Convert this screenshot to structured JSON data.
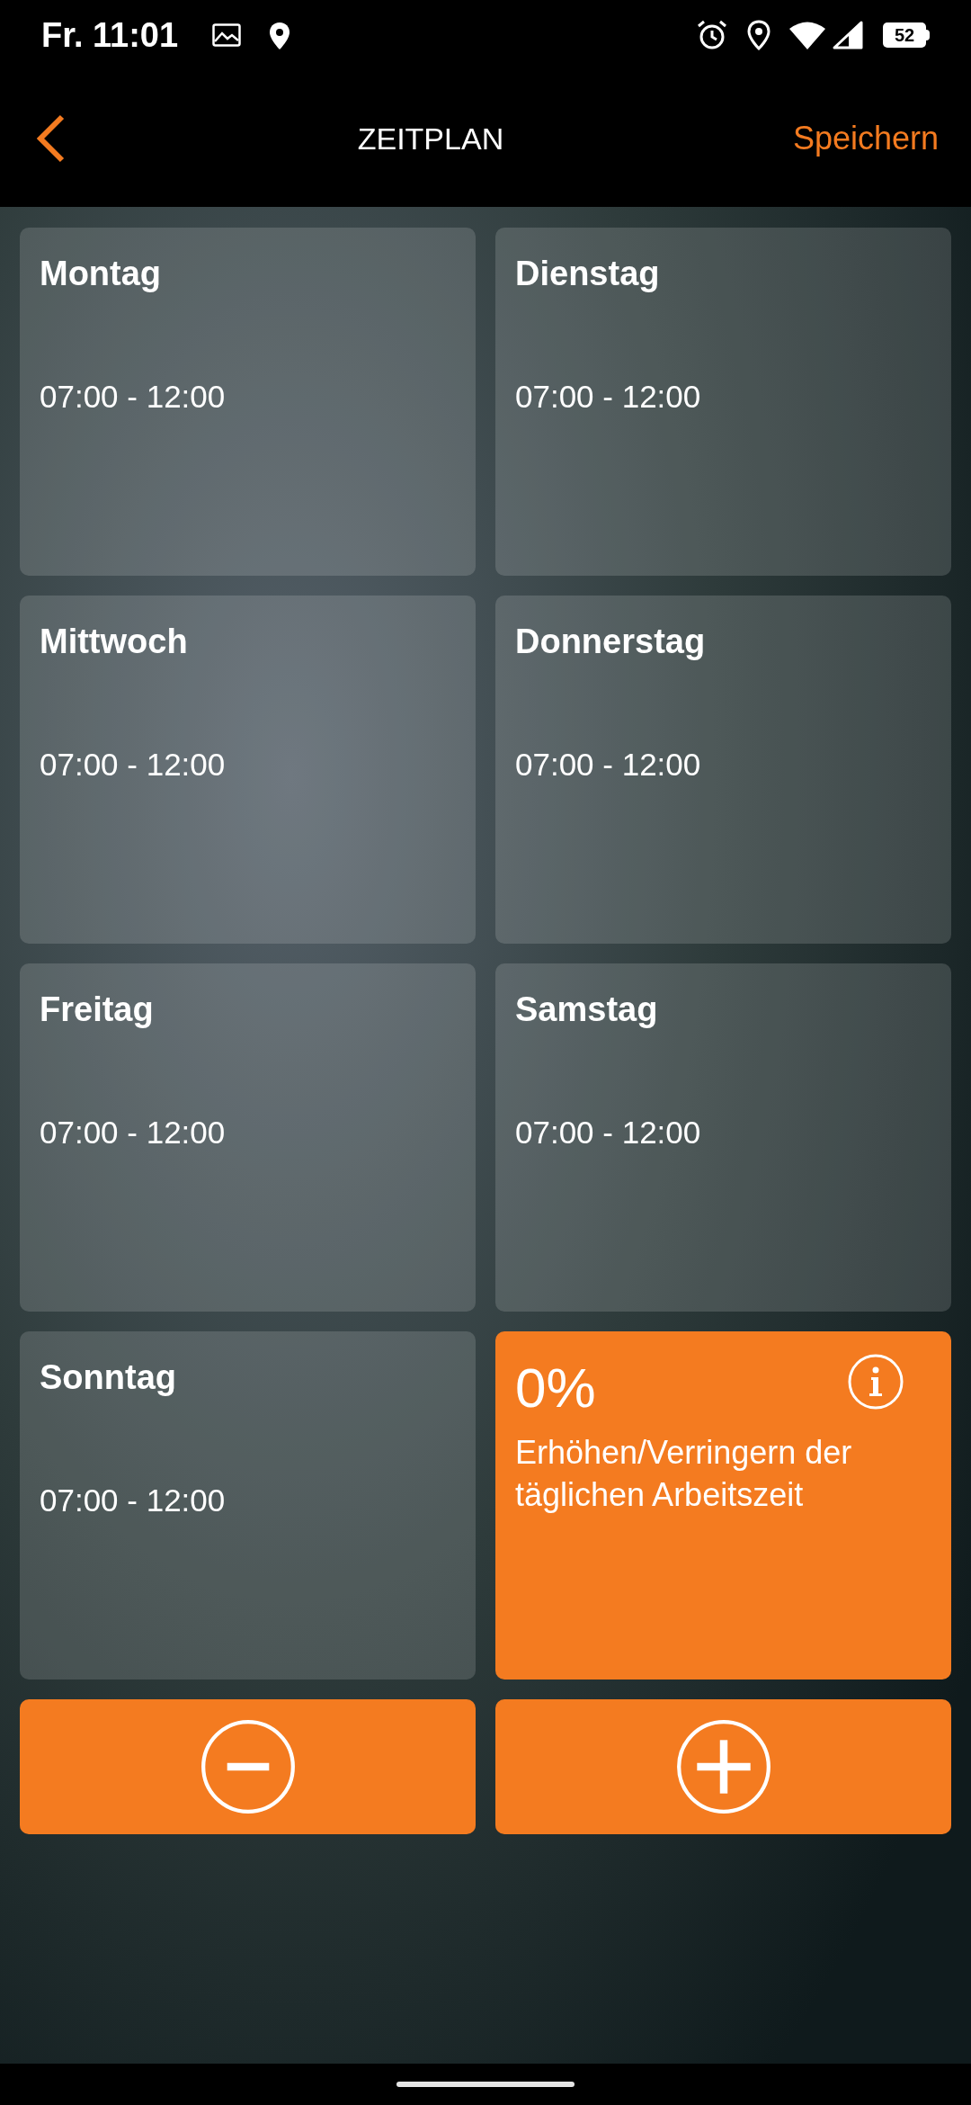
{
  "status_bar": {
    "time": "Fr. 11:01",
    "battery": "52"
  },
  "header": {
    "title": "ZEITPLAN",
    "action": "Speichern"
  },
  "days": [
    {
      "name": "Montag",
      "hours": "07:00 - 12:00"
    },
    {
      "name": "Dienstag",
      "hours": "07:00 - 12:00"
    },
    {
      "name": "Mittwoch",
      "hours": "07:00 - 12:00"
    },
    {
      "name": "Donnerstag",
      "hours": "07:00 - 12:00"
    },
    {
      "name": "Freitag",
      "hours": "07:00 - 12:00"
    },
    {
      "name": "Samstag",
      "hours": "07:00 - 12:00"
    },
    {
      "name": "Sonntag",
      "hours": "07:00 - 12:00"
    }
  ],
  "adjustment": {
    "value": "0%",
    "description": "Erhöhen/Verringern der täglichen Arbeitszeit"
  },
  "buttons": [
    {
      "kind": "decrease"
    },
    {
      "kind": "increase"
    }
  ]
}
